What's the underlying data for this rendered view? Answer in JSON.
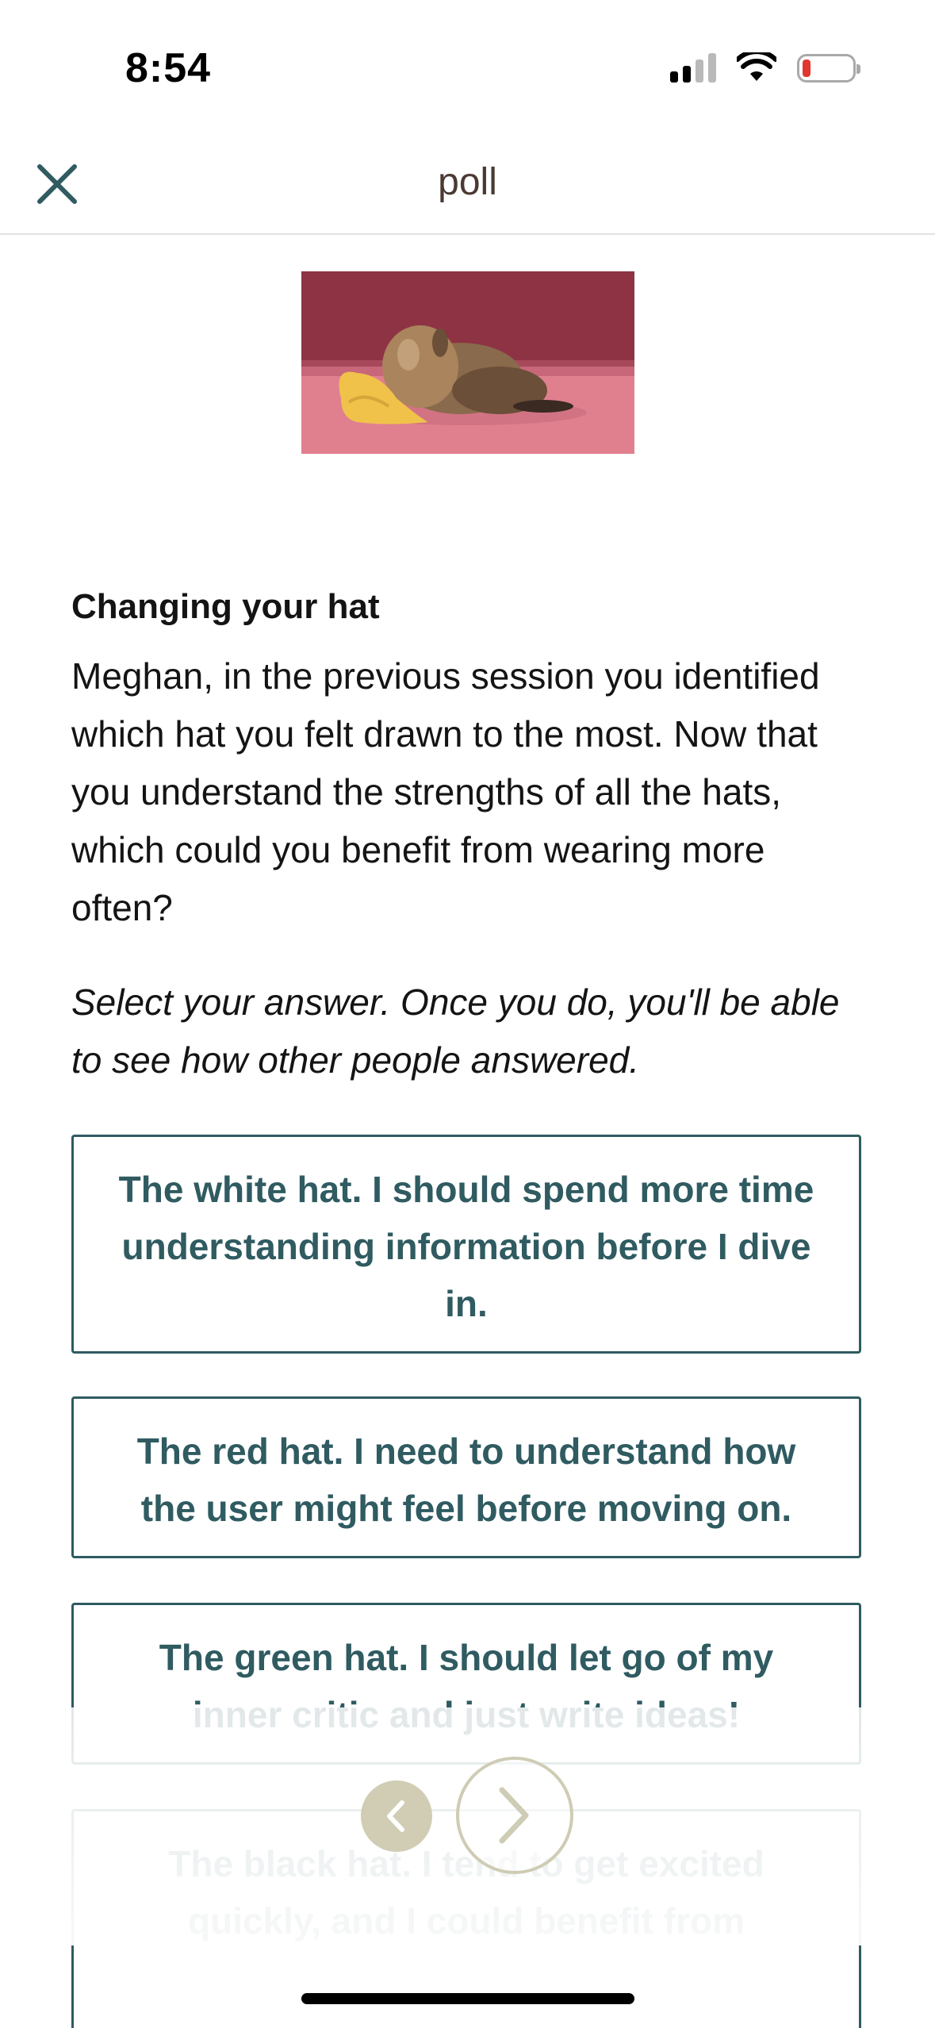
{
  "status_bar": {
    "time": "8:54"
  },
  "header": {
    "title": "poll"
  },
  "hero_image": {
    "alt": "puppy-with-yellow-hat",
    "colors": {
      "wall": "#8e3344",
      "floor": "#e0808f",
      "hat": "#f0c24a",
      "puppy": "#8a6a4c"
    }
  },
  "question": {
    "title": "Changing your hat",
    "body": "Meghan, in the previous session you identified which hat you felt drawn to the most. Now that you understand the strengths of all the hats, which could you benefit from wearing more often?",
    "instruction": "Select your answer. Once you do, you'll be able to see how other people answered."
  },
  "options": [
    {
      "label": "The white hat. I should spend more time understanding information before I dive in."
    },
    {
      "label": "The red hat. I need to understand how the user might feel before moving on."
    },
    {
      "label": "The green hat. I should let go of my inner critic and just write ideas!"
    },
    {
      "label": "The black hat. I tend to get excited quickly, and I could benefit from"
    }
  ],
  "navigation": {
    "prev_icon": "chevron-left-icon",
    "next_icon": "chevron-right-icon"
  },
  "colors": {
    "accent": "#2f5b61",
    "header_text": "#4a3a33",
    "nav_button": "#d0cdb4",
    "battery_low": "#e2362e"
  }
}
